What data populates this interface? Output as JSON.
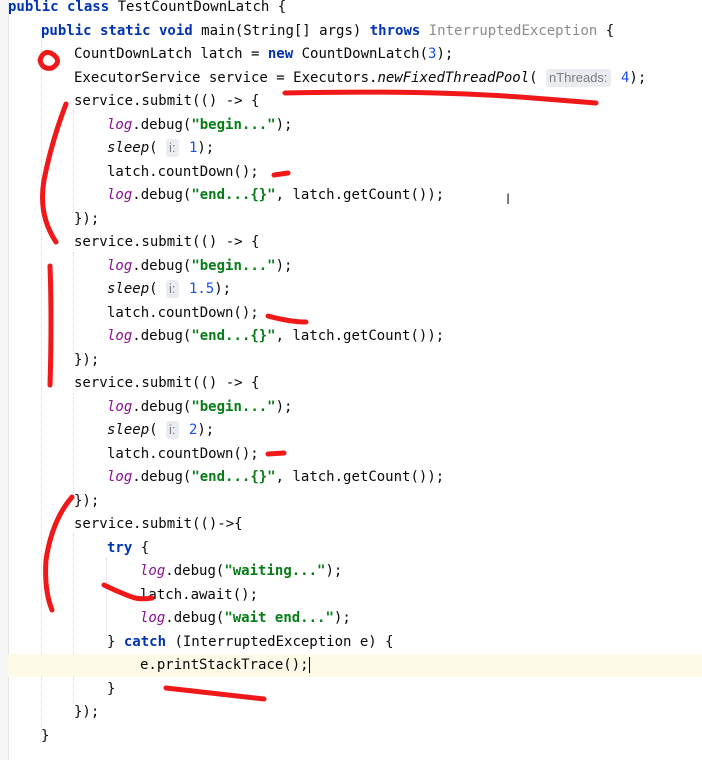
{
  "editor": {
    "lines": [
      {
        "indent": 0,
        "tokens": [
          {
            "t": "public class ",
            "c": "kw"
          },
          {
            "t": "TestCountDownLatch {",
            "c": "type"
          }
        ]
      },
      {
        "indent": 1,
        "tokens": [
          {
            "t": "public static void ",
            "c": "kw"
          },
          {
            "t": "main(String[] args) ",
            "c": "type"
          },
          {
            "t": "throws ",
            "c": "kw"
          },
          {
            "t": "InterruptedException",
            "c": "exc"
          },
          {
            "t": " {",
            "c": "type"
          }
        ]
      },
      {
        "indent": 2,
        "tokens": [
          {
            "t": "CountDownLatch latch = ",
            "c": "type"
          },
          {
            "t": "new ",
            "c": "kw"
          },
          {
            "t": "CountDownLatch(",
            "c": "type"
          },
          {
            "t": "3",
            "c": "num"
          },
          {
            "t": ");",
            "c": "type"
          }
        ]
      },
      {
        "indent": 2,
        "tokens": [
          {
            "t": "ExecutorService service = Executors.",
            "c": "type"
          },
          {
            "t": "newFixedThreadPool",
            "c": "italic"
          },
          {
            "t": "( ",
            "c": "type"
          },
          {
            "t": "nThreads:",
            "c": "hint"
          },
          {
            "t": " 4",
            "c": "num"
          },
          {
            "t": ");",
            "c": "type"
          }
        ]
      },
      {
        "indent": 2,
        "tokens": [
          {
            "t": "service.submit(() -> {",
            "c": "type"
          }
        ]
      },
      {
        "indent": 3,
        "tokens": [
          {
            "t": "log",
            "c": "field"
          },
          {
            "t": ".debug(",
            "c": "type"
          },
          {
            "t": "\"begin...\"",
            "c": "str"
          },
          {
            "t": ");",
            "c": "type"
          }
        ]
      },
      {
        "indent": 3,
        "tokens": [
          {
            "t": "sleep",
            "c": "italic"
          },
          {
            "t": "( ",
            "c": "type"
          },
          {
            "t": "i:",
            "c": "hint"
          },
          {
            "t": " 1",
            "c": "num"
          },
          {
            "t": ");",
            "c": "type"
          }
        ]
      },
      {
        "indent": 3,
        "tokens": [
          {
            "t": "latch.countDown();",
            "c": "type"
          }
        ]
      },
      {
        "indent": 3,
        "tokens": [
          {
            "t": "log",
            "c": "field"
          },
          {
            "t": ".debug(",
            "c": "type"
          },
          {
            "t": "\"end...{}\"",
            "c": "str"
          },
          {
            "t": ", latch.getCount());",
            "c": "type"
          }
        ]
      },
      {
        "indent": 2,
        "tokens": [
          {
            "t": "});",
            "c": "type"
          }
        ]
      },
      {
        "indent": 2,
        "tokens": [
          {
            "t": "service.submit(() -> {",
            "c": "type"
          }
        ]
      },
      {
        "indent": 3,
        "tokens": [
          {
            "t": "log",
            "c": "field"
          },
          {
            "t": ".debug(",
            "c": "type"
          },
          {
            "t": "\"begin...\"",
            "c": "str"
          },
          {
            "t": ");",
            "c": "type"
          }
        ]
      },
      {
        "indent": 3,
        "tokens": [
          {
            "t": "sleep",
            "c": "italic"
          },
          {
            "t": "( ",
            "c": "type"
          },
          {
            "t": "i:",
            "c": "hint"
          },
          {
            "t": " 1.5",
            "c": "num"
          },
          {
            "t": ");",
            "c": "type"
          }
        ]
      },
      {
        "indent": 3,
        "tokens": [
          {
            "t": "latch.countDown();",
            "c": "type"
          }
        ]
      },
      {
        "indent": 3,
        "tokens": [
          {
            "t": "log",
            "c": "field"
          },
          {
            "t": ".debug(",
            "c": "type"
          },
          {
            "t": "\"end...{}\"",
            "c": "str"
          },
          {
            "t": ", latch.getCount());",
            "c": "type"
          }
        ]
      },
      {
        "indent": 2,
        "tokens": [
          {
            "t": "});",
            "c": "type"
          }
        ]
      },
      {
        "indent": 2,
        "tokens": [
          {
            "t": "service.submit(() -> {",
            "c": "type"
          }
        ]
      },
      {
        "indent": 3,
        "tokens": [
          {
            "t": "log",
            "c": "field"
          },
          {
            "t": ".debug(",
            "c": "type"
          },
          {
            "t": "\"begin...\"",
            "c": "str"
          },
          {
            "t": ");",
            "c": "type"
          }
        ]
      },
      {
        "indent": 3,
        "tokens": [
          {
            "t": "sleep",
            "c": "italic"
          },
          {
            "t": "( ",
            "c": "type"
          },
          {
            "t": "i:",
            "c": "hint"
          },
          {
            "t": " 2",
            "c": "num"
          },
          {
            "t": ");",
            "c": "type"
          }
        ]
      },
      {
        "indent": 3,
        "tokens": [
          {
            "t": "latch.countDown();",
            "c": "type"
          }
        ]
      },
      {
        "indent": 3,
        "tokens": [
          {
            "t": "log",
            "c": "field"
          },
          {
            "t": ".debug(",
            "c": "type"
          },
          {
            "t": "\"end...{}\"",
            "c": "str"
          },
          {
            "t": ", latch.getCount());",
            "c": "type"
          }
        ]
      },
      {
        "indent": 2,
        "tokens": [
          {
            "t": "});",
            "c": "type"
          }
        ]
      },
      {
        "indent": 2,
        "tokens": [
          {
            "t": "service.submit(()->{",
            "c": "type"
          }
        ]
      },
      {
        "indent": 3,
        "tokens": [
          {
            "t": "try ",
            "c": "kw"
          },
          {
            "t": "{",
            "c": "type"
          }
        ]
      },
      {
        "indent": 4,
        "tokens": [
          {
            "t": "log",
            "c": "field"
          },
          {
            "t": ".debug(",
            "c": "type"
          },
          {
            "t": "\"waiting...\"",
            "c": "str"
          },
          {
            "t": ");",
            "c": "type"
          }
        ]
      },
      {
        "indent": 4,
        "tokens": [
          {
            "t": "latch.await();",
            "c": "type"
          }
        ]
      },
      {
        "indent": 4,
        "tokens": [
          {
            "t": "log",
            "c": "field"
          },
          {
            "t": ".debug(",
            "c": "type"
          },
          {
            "t": "\"wait end...\"",
            "c": "str"
          },
          {
            "t": ");",
            "c": "type"
          }
        ]
      },
      {
        "indent": 3,
        "tokens": [
          {
            "t": "} ",
            "c": "type"
          },
          {
            "t": "catch ",
            "c": "kw"
          },
          {
            "t": "(InterruptedException e) {",
            "c": "type"
          }
        ]
      },
      {
        "indent": 4,
        "current": true,
        "tokens": [
          {
            "t": "e.printStackTrace();",
            "c": "type"
          },
          {
            "t": "",
            "c": "caret"
          }
        ]
      },
      {
        "indent": 3,
        "tokens": [
          {
            "t": "}",
            "c": "type"
          }
        ]
      },
      {
        "indent": 2,
        "tokens": [
          {
            "t": "});",
            "c": "type"
          }
        ]
      },
      {
        "indent": 1,
        "tokens": [
          {
            "t": "}",
            "c": "type"
          }
        ]
      }
    ]
  },
  "colors": {
    "keyword": "#0033b3",
    "string": "#067d17",
    "number": "#1750eb",
    "annotation_ink": "#f01818",
    "current_line": "#fdfae8"
  },
  "icons": {
    "cursor": "text-ibeam-icon"
  }
}
